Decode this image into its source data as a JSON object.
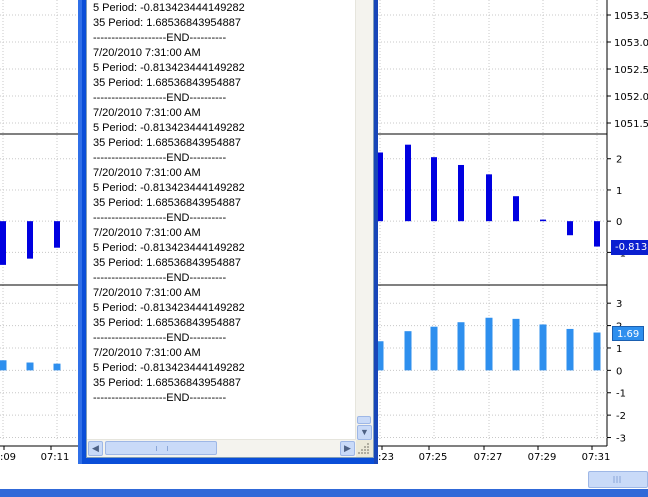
{
  "colors": {
    "osc_bar": "#0000e0",
    "hist_bar": "#2e8fee",
    "grid": "#c8c8c8",
    "badge_osc_bg": "#0a1fd0",
    "badge_hist_bg": "#2e8fee",
    "window_frame": "#0a4ed8"
  },
  "price_axis": {
    "labels": [
      "1053.5",
      "1053.0",
      "1052.5",
      "1052.0",
      "1051.5"
    ]
  },
  "chart_data": [
    {
      "type": "bar",
      "title": "",
      "panel": "oscillator",
      "ylim": [
        -1.5,
        2.6
      ],
      "y_ticks": [
        "2",
        "1",
        "0",
        "-1"
      ],
      "grid": true,
      "bars": [
        {
          "x": "07:08",
          "value": -1.4
        },
        {
          "x": "07:09",
          "value": -1.2
        },
        {
          "x": "07:11",
          "value": -0.85
        },
        {
          "x": "07:23",
          "value": 2.2
        },
        {
          "x": "07:24",
          "value": 2.45
        },
        {
          "x": "07:25",
          "value": 2.05
        },
        {
          "x": "07:26",
          "value": 1.8
        },
        {
          "x": "07:27",
          "value": 1.5
        },
        {
          "x": "07:28",
          "value": 0.8
        },
        {
          "x": "07:29",
          "value": 0.05
        },
        {
          "x": "07:30",
          "value": -0.45
        },
        {
          "x": "07:31",
          "value": -0.813
        }
      ],
      "last_value_label": "-0.813"
    },
    {
      "type": "bar",
      "title": "",
      "panel": "histogram",
      "ylim": [
        -3.2,
        3.5
      ],
      "y_ticks": [
        "3",
        "2",
        "1",
        "0",
        "-1",
        "-2",
        "-3"
      ],
      "grid": true,
      "bars": [
        {
          "x": "07:08",
          "value": 0.45
        },
        {
          "x": "07:09",
          "value": 0.35
        },
        {
          "x": "07:11",
          "value": 0.3
        },
        {
          "x": "07:23",
          "value": 1.3
        },
        {
          "x": "07:24",
          "value": 1.75
        },
        {
          "x": "07:25",
          "value": 1.95
        },
        {
          "x": "07:26",
          "value": 2.15
        },
        {
          "x": "07:27",
          "value": 2.35
        },
        {
          "x": "07:28",
          "value": 2.3
        },
        {
          "x": "07:29",
          "value": 2.05
        },
        {
          "x": "07:30",
          "value": 1.85
        },
        {
          "x": "07:31",
          "value": 1.69
        }
      ],
      "last_value_label": "1.69"
    }
  ],
  "time_axis": {
    "labels": [
      ":09",
      "07:11",
      ":23",
      "07:25",
      "07:27",
      "07:29",
      "07:31"
    ]
  },
  "output_window": {
    "partial_top_line": "7/20/2010 7:31:00 AM",
    "lines": [
      "5 Period: -0.813423444149282",
      "35 Period: 1.68536843954887",
      "--------------------END----------",
      "7/20/2010 7:31:00 AM",
      "5 Period: -0.813423444149282",
      "35 Period: 1.68536843954887",
      "--------------------END----------",
      "7/20/2010 7:31:00 AM",
      "5 Period: -0.813423444149282",
      "35 Period: 1.68536843954887",
      "--------------------END----------",
      "7/20/2010 7:31:00 AM",
      "5 Period: -0.813423444149282",
      "35 Period: 1.68536843954887",
      "--------------------END----------",
      "7/20/2010 7:31:00 AM",
      "5 Period: -0.813423444149282",
      "35 Period: 1.68536843954887",
      "--------------------END----------",
      "7/20/2010 7:31:00 AM",
      "5 Period: -0.813423444149282",
      "35 Period: 1.68536843954887",
      "--------------------END----------",
      "7/20/2010 7:31:00 AM",
      "5 Period: -0.813423444149282",
      "35 Period: 1.68536843954887",
      "--------------------END----------"
    ]
  },
  "icons": {
    "scroll_up": "scroll-up-arrow-icon",
    "scroll_down": "scroll-down-arrow-icon",
    "scroll_left": "scroll-left-arrow-icon",
    "scroll_right": "scroll-right-arrow-icon",
    "resize_grip": "resize-grip-icon",
    "scroll_up_glyph": "▲",
    "scroll_down_glyph": "▼",
    "scroll_left_glyph": "◀",
    "scroll_right_glyph": "▶"
  }
}
